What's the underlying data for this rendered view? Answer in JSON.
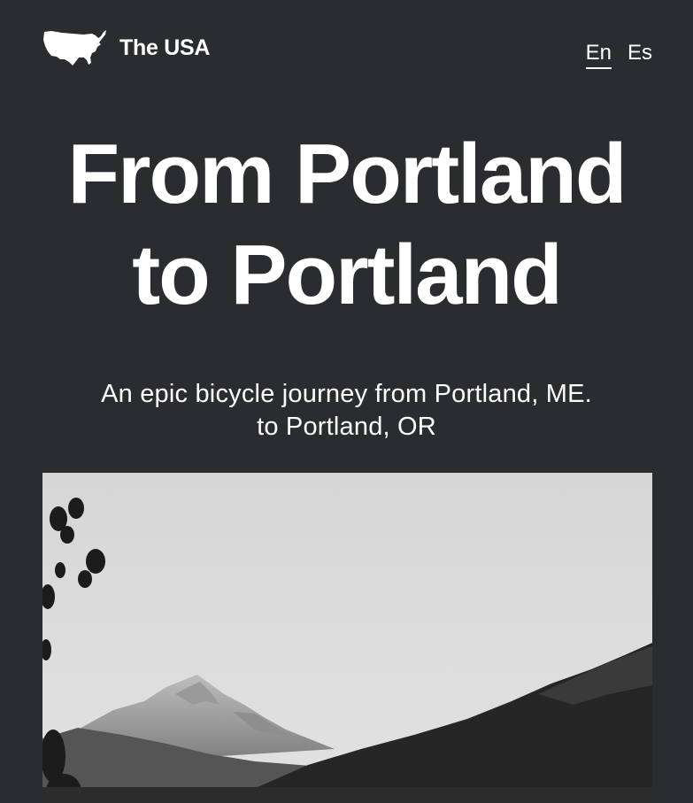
{
  "header": {
    "brand_name": "The USA",
    "brand_icon": "usa-map-icon",
    "languages": [
      {
        "label": "En",
        "active": true
      },
      {
        "label": "Es",
        "active": false
      }
    ]
  },
  "hero": {
    "title_line1": "From Portland",
    "title_line2": "to Portland",
    "subtitle_line1": "An epic bicycle journey from Portland, ME.",
    "subtitle_line2": "to Portland, OR"
  },
  "photo": {
    "subject": "mountain-landscape-image"
  },
  "colors": {
    "background": "#2b2c30",
    "text": "#ffffff"
  }
}
